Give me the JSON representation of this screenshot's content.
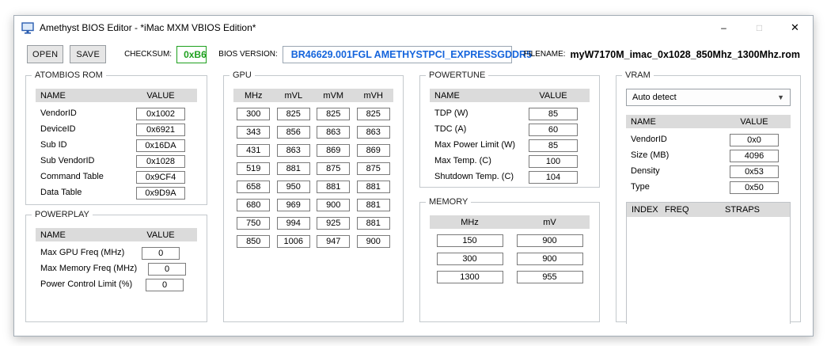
{
  "window": {
    "title": "Amethyst BIOS Editor - *iMac MXM VBIOS Edition*",
    "controls": {
      "minimize": "–",
      "maximize": "□",
      "close": "✕"
    }
  },
  "toolbar": {
    "open_label": "OPEN",
    "save_label": "SAVE",
    "checksum_label": "CHECKSUM:",
    "checksum_value": "0xB6",
    "checksum_color": "#1ea01e",
    "bios_version_label": "BIOS VERSION:",
    "bios_version_value": "BR46629.001FGL AMETHYSTPCI_EXPRESSGDDR5",
    "bios_version_color": "#1464dc",
    "filename_label": "FILENAME:",
    "filename_value": "myW7170M_imac_0x1028_850Mhz_1300Mhz.rom"
  },
  "atombios_rom": {
    "title": "ATOMBIOS ROM",
    "headers": [
      "NAME",
      "VALUE"
    ],
    "rows": [
      {
        "name": "VendorID",
        "value": "0x1002"
      },
      {
        "name": "DeviceID",
        "value": "0x6921"
      },
      {
        "name": "Sub ID",
        "value": "0x16DA"
      },
      {
        "name": "Sub VendorID",
        "value": "0x1028"
      },
      {
        "name": "Command Table",
        "value": "0x9CF4"
      },
      {
        "name": "Data Table",
        "value": "0x9D9A"
      }
    ]
  },
  "powerplay": {
    "title": "POWERPLAY",
    "headers": [
      "NAME",
      "VALUE"
    ],
    "rows": [
      {
        "name": "Max GPU Freq (MHz)",
        "value": "0"
      },
      {
        "name": "Max Memory Freq (MHz)",
        "value": "0"
      },
      {
        "name": "Power Control Limit (%)",
        "value": "0"
      }
    ]
  },
  "gpu": {
    "title": "GPU",
    "headers": [
      "MHz",
      "mVL",
      "mVM",
      "mVH"
    ],
    "rows": [
      [
        "300",
        "825",
        "825",
        "825"
      ],
      [
        "343",
        "856",
        "863",
        "863"
      ],
      [
        "431",
        "863",
        "869",
        "869"
      ],
      [
        "519",
        "881",
        "875",
        "875"
      ],
      [
        "658",
        "950",
        "881",
        "881"
      ],
      [
        "680",
        "969",
        "900",
        "881"
      ],
      [
        "750",
        "994",
        "925",
        "881"
      ],
      [
        "850",
        "1006",
        "947",
        "900"
      ]
    ]
  },
  "powertune": {
    "title": "POWERTUNE",
    "headers": [
      "NAME",
      "VALUE"
    ],
    "rows": [
      {
        "name": "TDP (W)",
        "value": "85"
      },
      {
        "name": "TDC (A)",
        "value": "60"
      },
      {
        "name": "Max Power Limit (W)",
        "value": "85"
      },
      {
        "name": "Max Temp. (C)",
        "value": "100"
      },
      {
        "name": "Shutdown Temp. (C)",
        "value": "104"
      }
    ]
  },
  "memory": {
    "title": "MEMORY",
    "headers": [
      "MHz",
      "mV"
    ],
    "rows": [
      [
        "150",
        "900"
      ],
      [
        "300",
        "900"
      ],
      [
        "1300",
        "955"
      ]
    ]
  },
  "vram": {
    "title": "VRAM",
    "dropdown_value": "Auto detect",
    "headers": [
      "NAME",
      "VALUE"
    ],
    "rows": [
      {
        "name": "VendorID",
        "value": "0x0"
      },
      {
        "name": "Size (MB)",
        "value": "4096"
      },
      {
        "name": "Density",
        "value": "0x53"
      },
      {
        "name": "Type",
        "value": "0x50"
      }
    ],
    "straps_headers": [
      "INDEX",
      "FREQ",
      "STRAPS"
    ]
  }
}
